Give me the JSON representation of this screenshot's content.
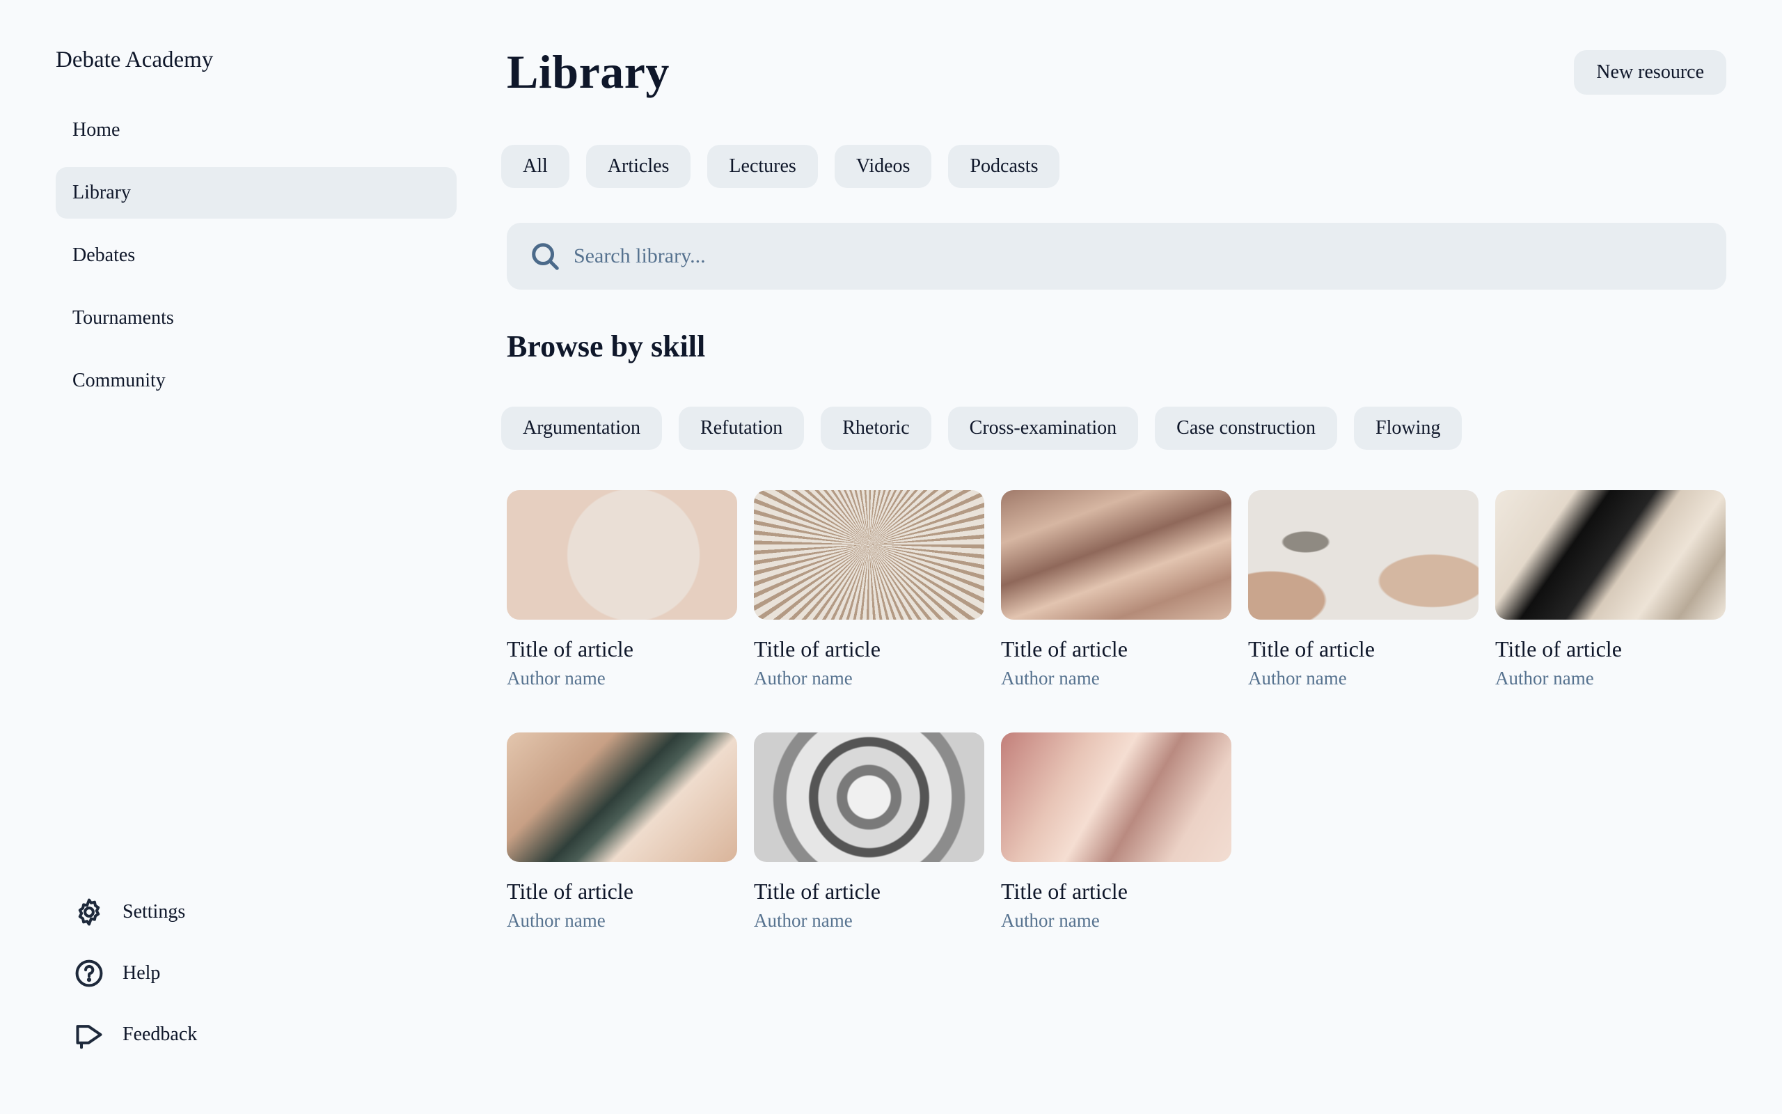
{
  "app": {
    "brand": "Debate Academy"
  },
  "sidebar": {
    "items": [
      {
        "label": "Home",
        "active": false
      },
      {
        "label": "Library",
        "active": true
      },
      {
        "label": "Debates",
        "active": false
      },
      {
        "label": "Tournaments",
        "active": false
      },
      {
        "label": "Community",
        "active": false
      }
    ],
    "footer": [
      {
        "label": "Settings",
        "icon": "gear-icon"
      },
      {
        "label": "Help",
        "icon": "help-icon"
      },
      {
        "label": "Feedback",
        "icon": "megaphone-icon"
      }
    ]
  },
  "header": {
    "title": "Library",
    "new_button": "New resource"
  },
  "filters": [
    "All",
    "Articles",
    "Lectures",
    "Videos",
    "Podcasts"
  ],
  "search": {
    "placeholder": "Search library..."
  },
  "browse": {
    "title": "Browse by skill",
    "skills": [
      "Argumentation",
      "Refutation",
      "Rhetoric",
      "Cross-examination",
      "Case construction",
      "Flowing"
    ]
  },
  "cards": [
    {
      "title": "Title of article",
      "author": "Author name"
    },
    {
      "title": "Title of article",
      "author": "Author name"
    },
    {
      "title": "Title of article",
      "author": "Author name"
    },
    {
      "title": "Title of article",
      "author": "Author name"
    },
    {
      "title": "Title of article",
      "author": "Author name"
    },
    {
      "title": "Title of article",
      "author": "Author name"
    },
    {
      "title": "Title of article",
      "author": "Author name"
    },
    {
      "title": "Title of article",
      "author": "Author name"
    }
  ],
  "colors": {
    "background": "#f8fafc",
    "chip": "#e8edf1",
    "muted_text": "#56728f",
    "text": "#0f172a"
  }
}
